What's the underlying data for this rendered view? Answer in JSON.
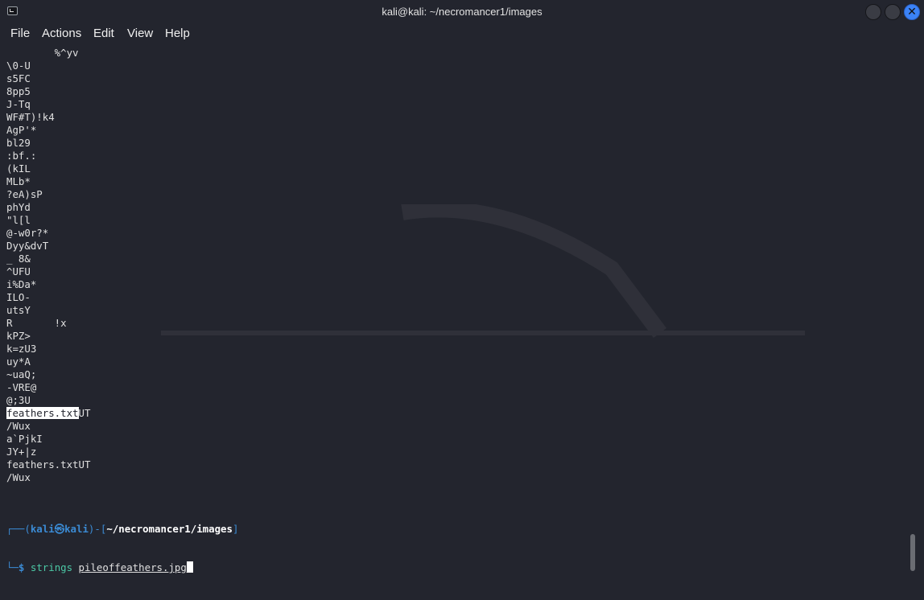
{
  "window": {
    "title": "kali@kali: ~/necromancer1/images",
    "icon": "terminal-icon",
    "controls": [
      "minimize-button",
      "maximize-button",
      "close-button"
    ],
    "close_glyph": "✕",
    "accent_color": "#3b82f6"
  },
  "menu": {
    "items": [
      "File",
      "Actions",
      "Edit",
      "View",
      "Help"
    ]
  },
  "output": {
    "lines": [
      "        %^yv",
      "\\0-U",
      "s5FC",
      "8pp5",
      "J-Tq",
      "WF#T)!k4",
      "AgP'*",
      "bl29",
      ":bf.:",
      "(kIL",
      "MLb*",
      "?eA)sP",
      "phYd",
      "\"l[l",
      "@-w0r?*",
      "Dyy&dvT",
      "_ 8&",
      "^UFU",
      "i%Da*",
      "ILO-",
      "utsY",
      "R       !x",
      "kPZ>",
      "k=zU3",
      "uy*A",
      "~uaQ;",
      "-VRE@",
      "@;3U",
      "feathers.txtUT",
      "/Wux",
      "a`PjkI",
      "JY+|z",
      "feathers.txtUT",
      "/Wux"
    ],
    "highlighted_text": "feathers.txt",
    "highlighted_suffix": "UT"
  },
  "prompt": {
    "open": "┌──(",
    "user": "kali",
    "at": "㉿",
    "host": "kali",
    "mid": ")-[",
    "path": "~/necromancer1/images",
    "close": "]",
    "corner": "└─",
    "dollar": "$",
    "command": "strings",
    "argument": "pileoffeathers.jpg"
  }
}
